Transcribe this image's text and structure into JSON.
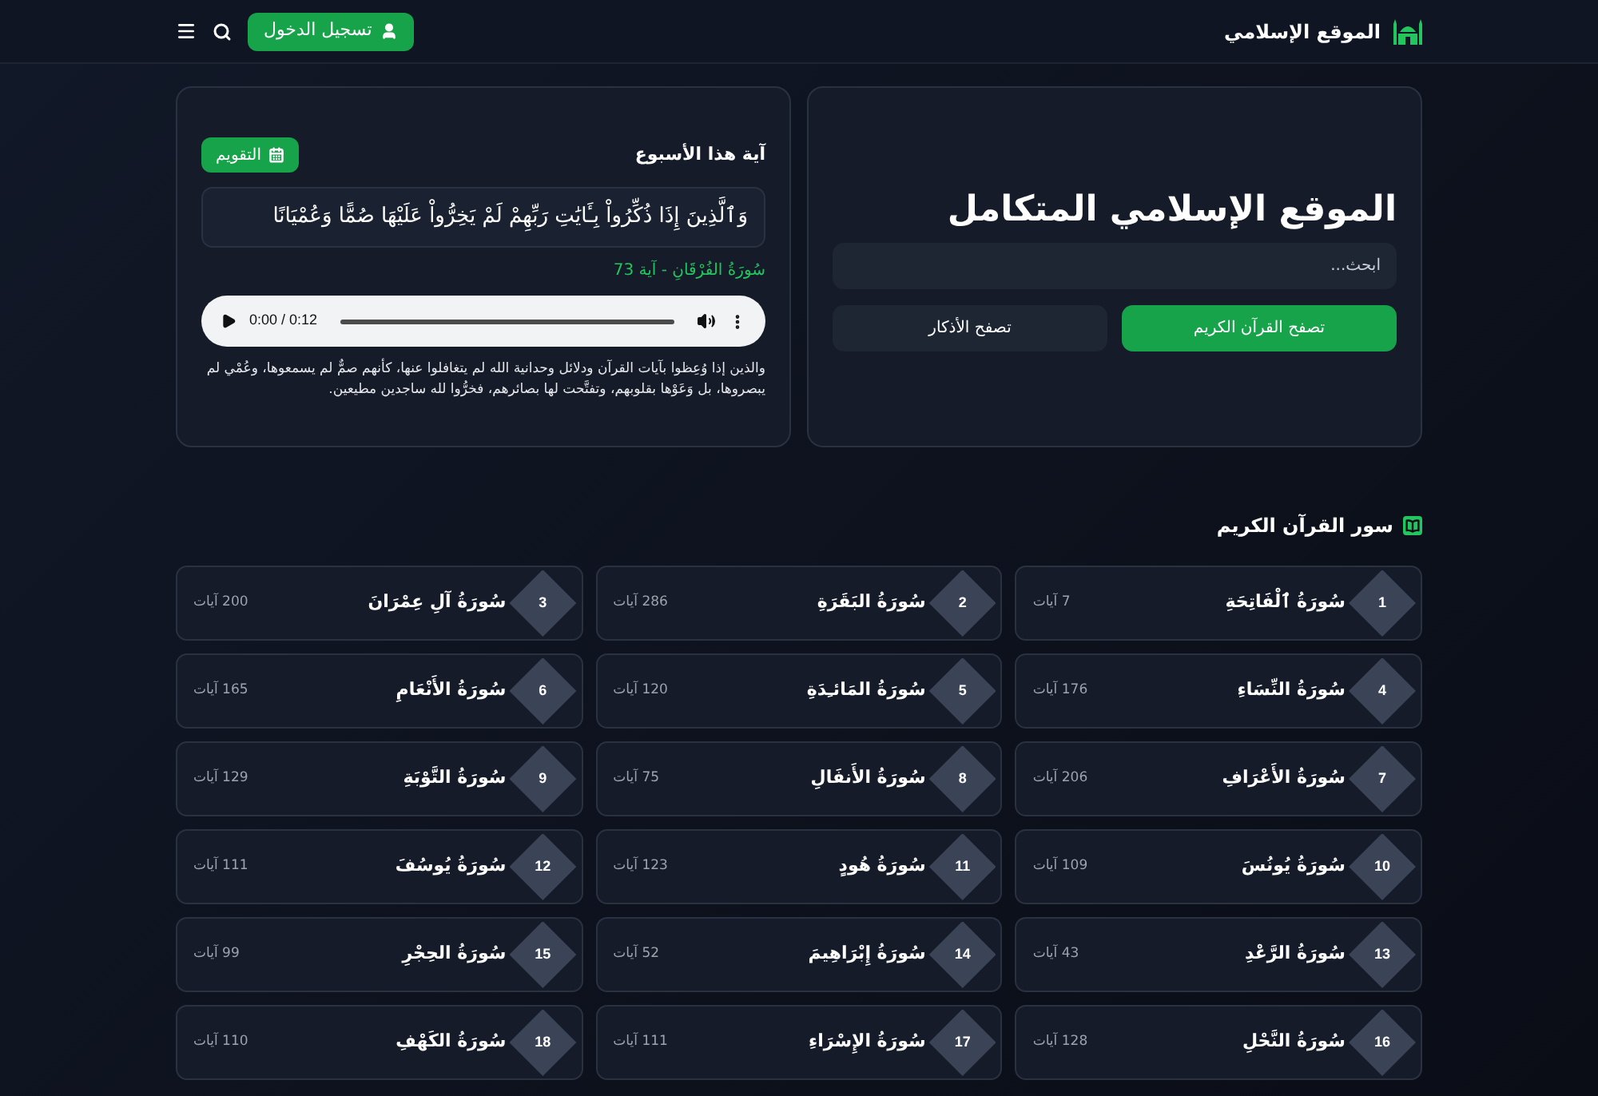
{
  "header": {
    "logo_text": "الموقع الإسلامي",
    "login_button": "تسجيل الدخول"
  },
  "hero": {
    "title": "الموقع الإسلامي المتكامل",
    "search": {
      "placeholder": "ابحث..."
    },
    "buttons": [
      {
        "label": "تصفح القرآن الكريم",
        "kind": "primary"
      },
      {
        "label": "تصفح الأذكار",
        "kind": "secondary"
      }
    ]
  },
  "verse_of_week": {
    "title": "آية هذا الأسبوع",
    "calendar_button": "التقويم",
    "verse": "وَٱلَّذِينَ إِذَا ذُكِّرُواْ بِـَٔايَٰتِ رَبِّهِمْ لَمْ يَخِرُّواْ عَلَيْهَا صُمًّا وَعُمْيَانًا",
    "reference": "سُورَةُ الفُرْقَانِ - آية 73",
    "audio": {
      "time": "0:00 / 0:12",
      "level": 0
    },
    "tafsir": "والذين إذا وُعِظوا بآيات القرآن ودلائل وحدانية الله لم يتغافلوا عنها، كأنهم صمٌّ لم يسمعوها، وعُمْي لم يبصروها، بل وَعَوْها بقلوبهم، وتفتَّحت لها بصائرهم، فخرُّوا لله ساجدين مطيعين."
  },
  "surahs": {
    "title": "سور القرآن الكريم",
    "items": [
      {
        "number": "1",
        "name": "سُورَةُ ٱلْفَاتِحَةِ",
        "verses": "7 آيات"
      },
      {
        "number": "2",
        "name": "سُورَةُ البَقَرَةِ",
        "verses": "286 آيات"
      },
      {
        "number": "3",
        "name": "سُورَةُ آلِ عِمْرَانَ",
        "verses": "200 آيات"
      },
      {
        "number": "4",
        "name": "سُورَةُ النِّسَاءِ",
        "verses": "176 آيات"
      },
      {
        "number": "5",
        "name": "سُورَةُ المَائـِدَةِ",
        "verses": "120 آيات"
      },
      {
        "number": "6",
        "name": "سُورَةُ الأَنْعَامِ",
        "verses": "165 آيات"
      },
      {
        "number": "7",
        "name": "سُورَةُ الأَعْرَافِ",
        "verses": "206 آيات"
      },
      {
        "number": "8",
        "name": "سُورَةُ الأَنفَالِ",
        "verses": "75 آيات"
      },
      {
        "number": "9",
        "name": "سُورَةُ التَّوْبَةِ",
        "verses": "129 آيات"
      },
      {
        "number": "10",
        "name": "سُورَةُ يُونُسَ",
        "verses": "109 آيات"
      },
      {
        "number": "11",
        "name": "سُورَةُ هُودٍ",
        "verses": "123 آيات"
      },
      {
        "number": "12",
        "name": "سُورَةُ يُوسُفَ",
        "verses": "111 آيات"
      },
      {
        "number": "13",
        "name": "سُورَةُ الرَّعْدِ",
        "verses": "43 آيات"
      },
      {
        "number": "14",
        "name": "سُورَةُ إِبْرَاهِيمَ",
        "verses": "52 آيات"
      },
      {
        "number": "15",
        "name": "سُورَةُ الحِجْرِ",
        "verses": "99 آيات"
      },
      {
        "number": "16",
        "name": "سُورَةُ النَّحْلِ",
        "verses": "128 آيات"
      },
      {
        "number": "17",
        "name": "سُورَةُ الإِسْرَاءِ",
        "verses": "111 آيات"
      },
      {
        "number": "18",
        "name": "سُورَةُ الكَهْفِ",
        "verses": "110 آيات"
      }
    ]
  }
}
